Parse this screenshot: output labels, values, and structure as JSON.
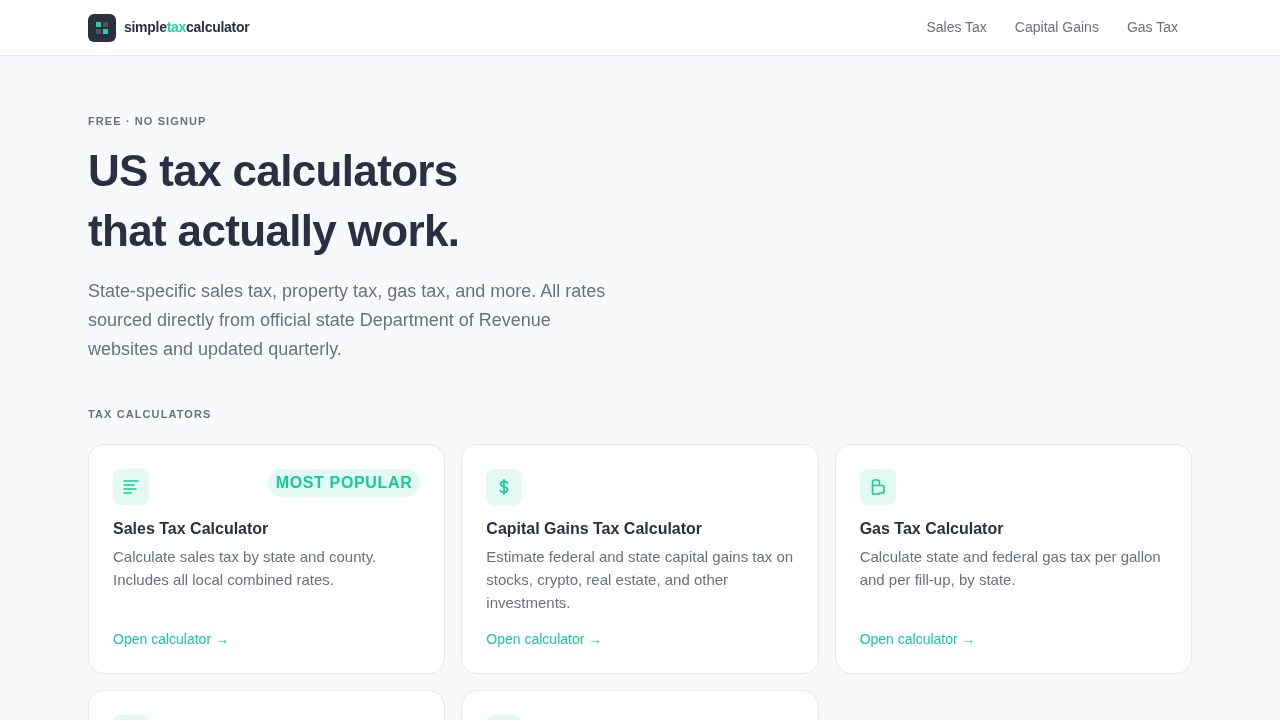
{
  "header": {
    "brand": [
      {
        "text": "simple",
        "accent": false
      },
      {
        "text": "tax",
        "accent": true
      },
      {
        "text": "calculator",
        "accent": false
      }
    ],
    "nav": [
      "Sales Tax",
      "Capital Gains",
      "Gas Tax"
    ]
  },
  "hero": {
    "eyebrow": "FREE · NO SIGNUP",
    "title_lines": [
      "US tax calculators",
      "that actually work."
    ],
    "lead": "State-specific sales tax, property tax, gas tax, and more. All rates sourced directly from official state Department of Revenue websites and updated quarterly."
  },
  "section": {
    "label": "TAX CALCULATORS"
  },
  "cards": [
    {
      "kind": "sales",
      "badge": "MOST POPULAR",
      "title": "Sales Tax Calculator",
      "description": "Calculate sales tax by state and county. Includes all local combined rates.",
      "link": "Open calculator →"
    },
    {
      "kind": "gains",
      "title": "Capital Gains Tax Calculator",
      "description": "Estimate federal and state capital gains tax on stocks, crypto, real estate, and other investments.",
      "link": "Open calculator →"
    },
    {
      "kind": "gas",
      "title": "Gas Tax Calculator",
      "description": "Calculate state and federal gas tax per gallon and per fill-up, by state.",
      "link": "Open calculator →"
    }
  ],
  "partial_cards": [
    {
      "kind": "cut-off"
    },
    {
      "kind": "cut-off"
    }
  ]
}
